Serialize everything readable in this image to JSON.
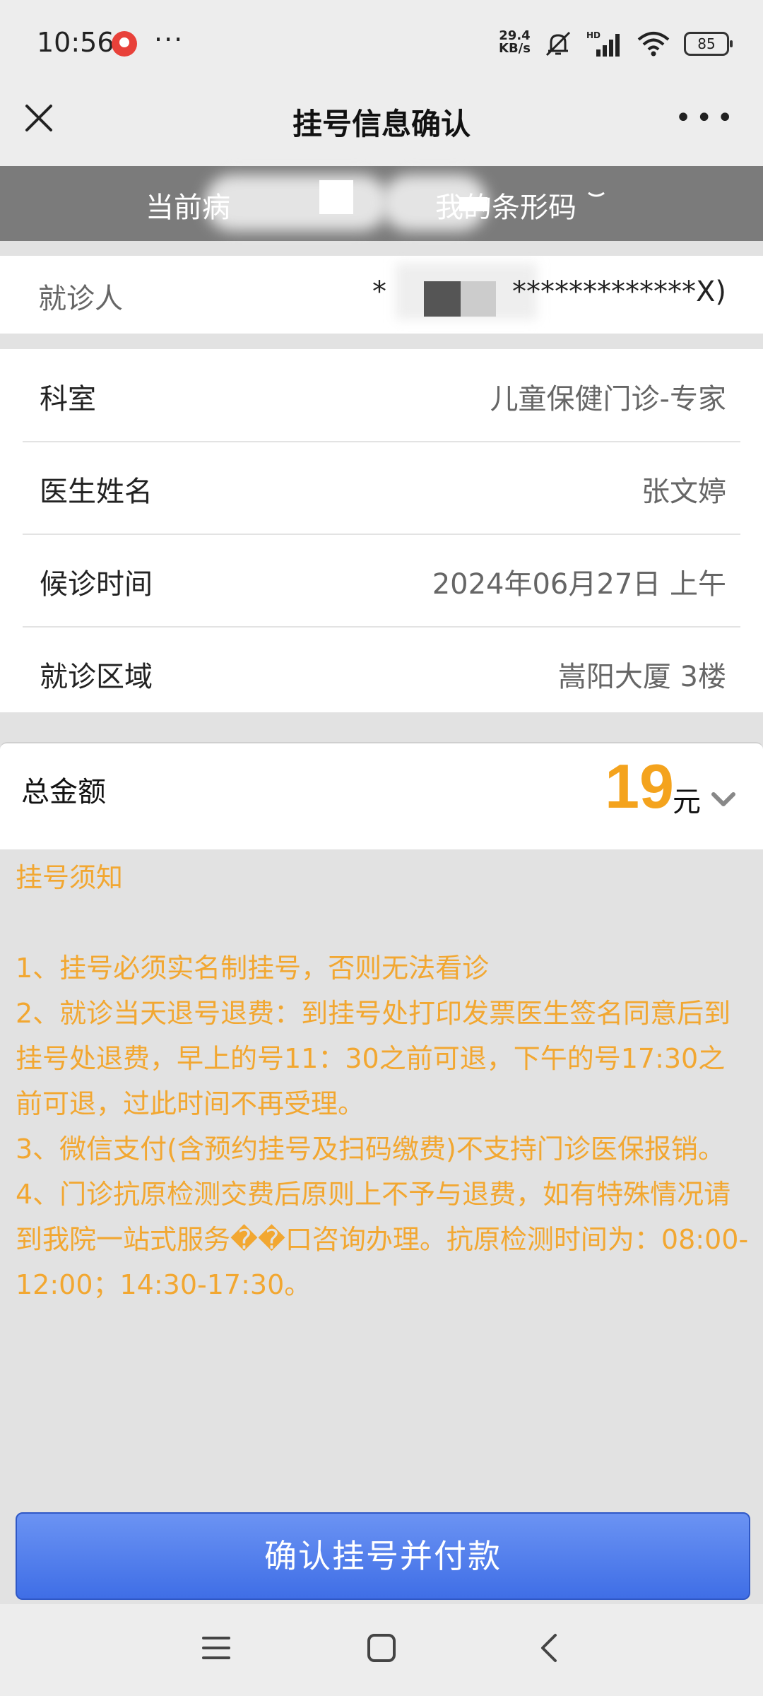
{
  "status_bar": {
    "time": "10:56",
    "dots": "···",
    "net_speed_value": "29.4",
    "net_speed_unit": "KB/s",
    "battery": "85"
  },
  "nav": {
    "title": "挂号信息确认",
    "more": "•••"
  },
  "banner": {
    "left_text": "当前病",
    "right_text": "我的条形码"
  },
  "patient": {
    "label": "就诊人",
    "value": "*              *************X)"
  },
  "details": [
    {
      "label": "科室",
      "value": "儿童保健门诊-专家"
    },
    {
      "label": "医生姓名",
      "value": "张文婷"
    },
    {
      "label": "候诊时间",
      "value": "2024年06月27日 上午"
    },
    {
      "label": "就诊区域",
      "value": "嵩阳大厦 3楼"
    }
  ],
  "amount": {
    "label": "总金额",
    "value": "19",
    "unit": "元"
  },
  "notice": {
    "title": "挂号须知",
    "items": [
      "1、挂号必须实名制挂号，否则无法看诊",
      "2、就诊当天退号退费：到挂号处打印发票医生签名同意后到挂号处退费，早上的号11：30之前可退，下午的号17:30之前可退，过此时间不再受理。",
      "3、微信支付(含预约挂号及扫码缴费)不支持门诊医保报销。",
      "4、门诊抗原检测交费后原则上不予与退费，如有特殊情况请到我院一站式服务��口咨询办理。抗原检测时间为：08:00-12:00；14:30-17:30。"
    ]
  },
  "confirm_button": "确认挂号并付款",
  "colors": {
    "accent_orange": "#f4a31d",
    "button_blue": "#4a78ea",
    "banner_gray": "#7b7b7b"
  },
  "icons": [
    "close-icon",
    "more-icon",
    "chevron-down-icon",
    "menu-icon",
    "home-icon",
    "back-icon",
    "wifi-icon",
    "signal-icon",
    "mute-icon"
  ]
}
